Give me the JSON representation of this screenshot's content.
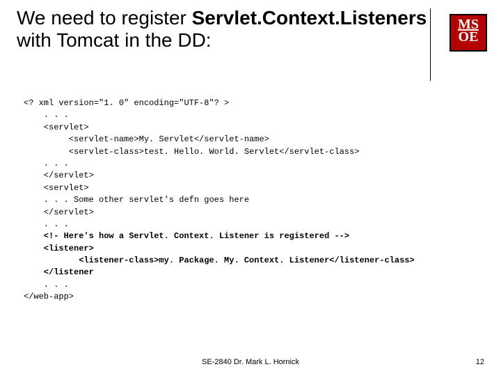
{
  "title": {
    "part1": "We need to register ",
    "bold": "Servlet.Context.Listeners",
    "part2": " with Tomcat in the DD:"
  },
  "logo": {
    "line1": "MS",
    "line2": "OE"
  },
  "code": {
    "l01": "<? xml version=\"1. 0\" encoding=\"UTF-8\"? >",
    "l02": "    . . .",
    "l03": "    <servlet>",
    "l04": "         <servlet-name>My. Servlet</servlet-name>",
    "l05": "         <servlet-class>test. Hello. World. Servlet</servlet-class>",
    "l06": "    . . .",
    "l07": "    </servlet>",
    "l08": "    <servlet>",
    "l09": "    . . . Some other servlet's defn goes here",
    "l10": "    </servlet>",
    "l11": "    . . .",
    "l12": "    <!- Here's how a Servlet. Context. Listener is registered -->",
    "l13": "    <listener>",
    "l14": "           <listener-class>my. Package. My. Context. Listener</listener-class>",
    "l15": "    </listener",
    "l16": "    . . .",
    "l17": "</web-app>"
  },
  "footer": {
    "center": "SE-2840 Dr. Mark L. Hornick",
    "page": "12"
  }
}
